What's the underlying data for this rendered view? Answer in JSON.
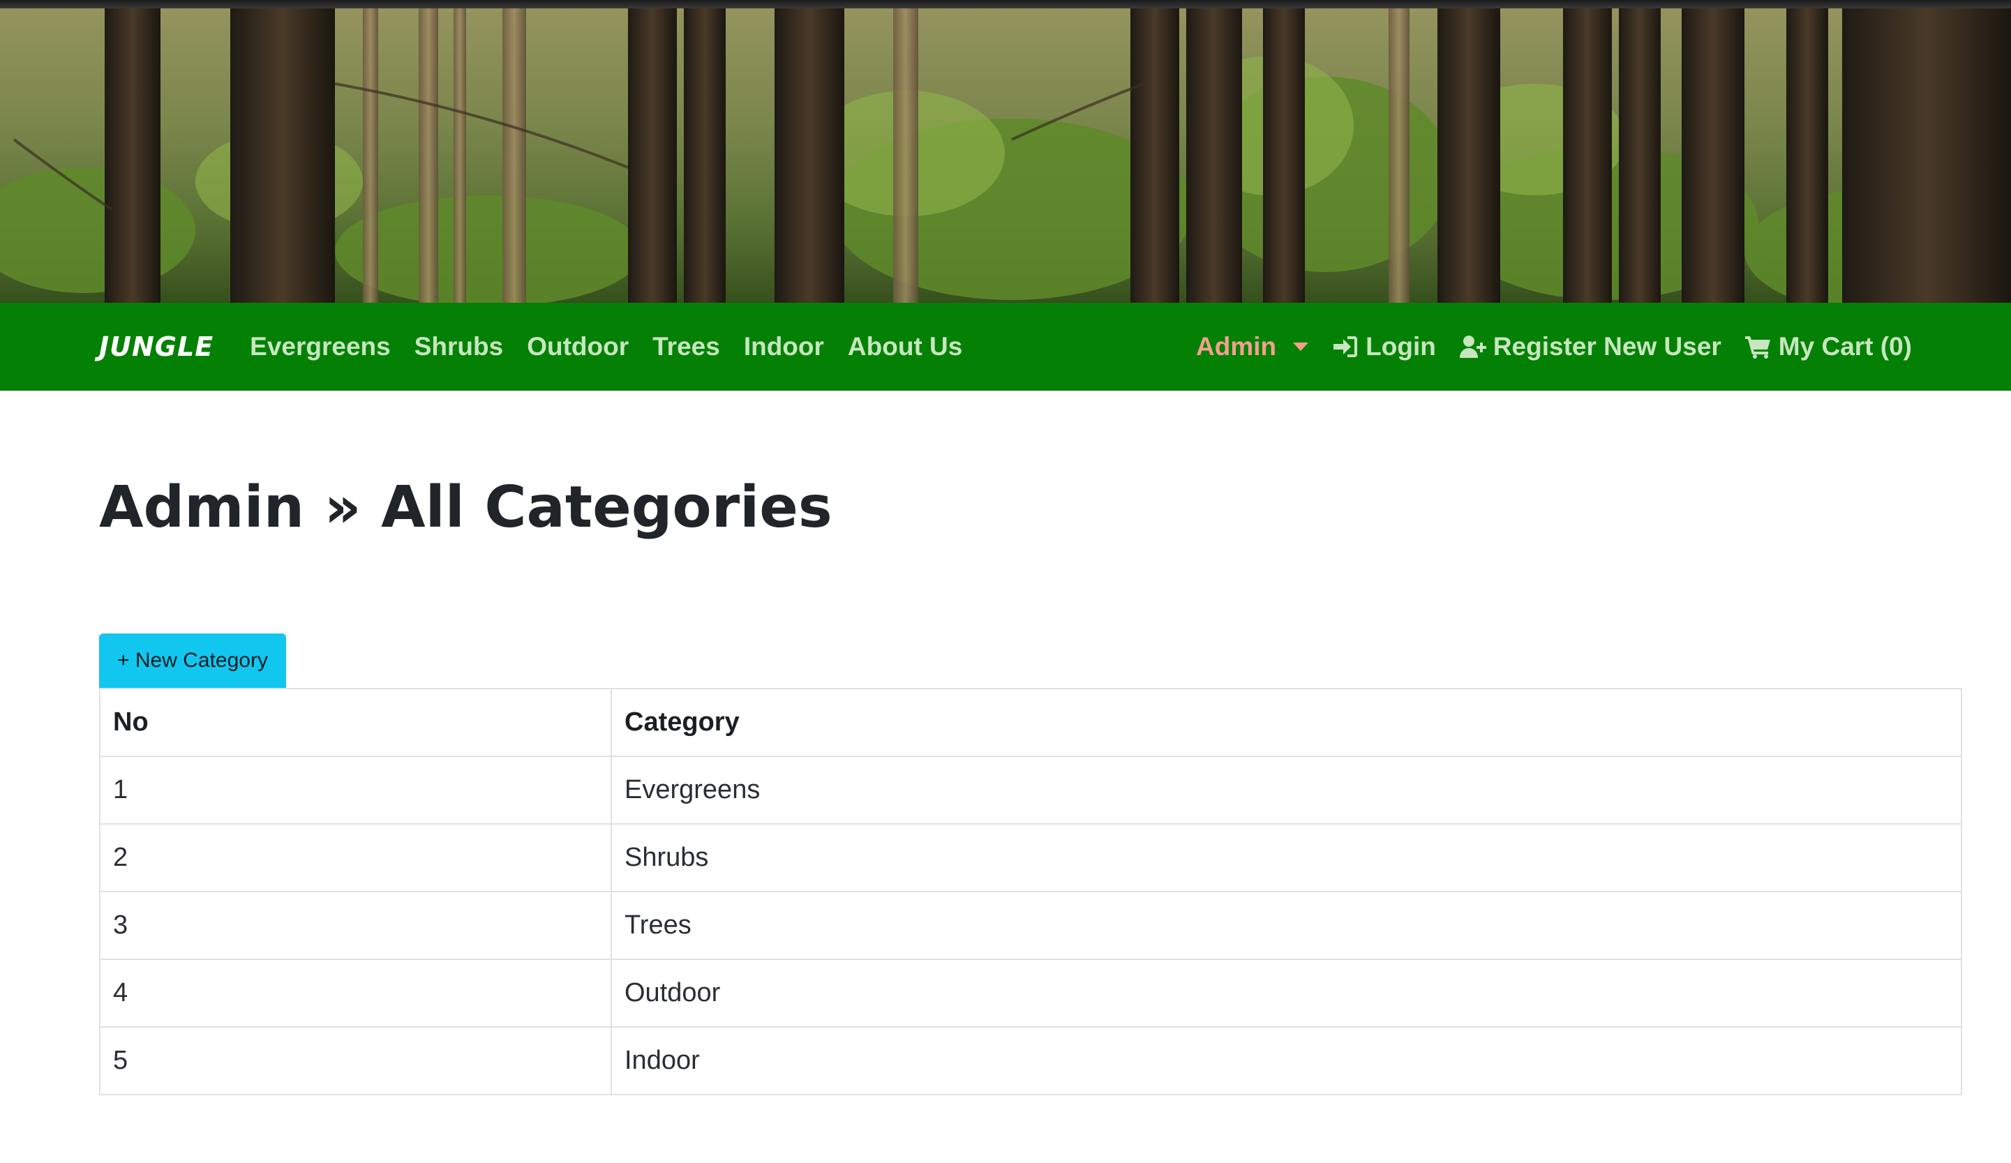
{
  "navbar": {
    "brand": "JUNGLE",
    "links": [
      "Evergreens",
      "Shrubs",
      "Outdoor",
      "Trees",
      "Indoor",
      "About Us"
    ],
    "admin_label": "Admin",
    "login_label": "Login",
    "register_label": "Register New User",
    "cart_label": "My Cart (0)"
  },
  "page": {
    "title": "Admin » All Categories",
    "new_button": "+ New Category"
  },
  "table": {
    "headers": [
      "No",
      "Category"
    ],
    "rows": [
      [
        "1",
        "Evergreens"
      ],
      [
        "2",
        "Shrubs"
      ],
      [
        "3",
        "Trees"
      ],
      [
        "4",
        "Outdoor"
      ],
      [
        "5",
        "Indoor"
      ]
    ]
  },
  "colors": {
    "navbar": "#048104",
    "nav_link": "#c8e6c0",
    "admin_link": "#f2a08f",
    "button": "#12c7ef"
  },
  "icons": {
    "login": "sign-in-icon",
    "register": "user-plus-icon",
    "cart": "shopping-cart-icon"
  }
}
